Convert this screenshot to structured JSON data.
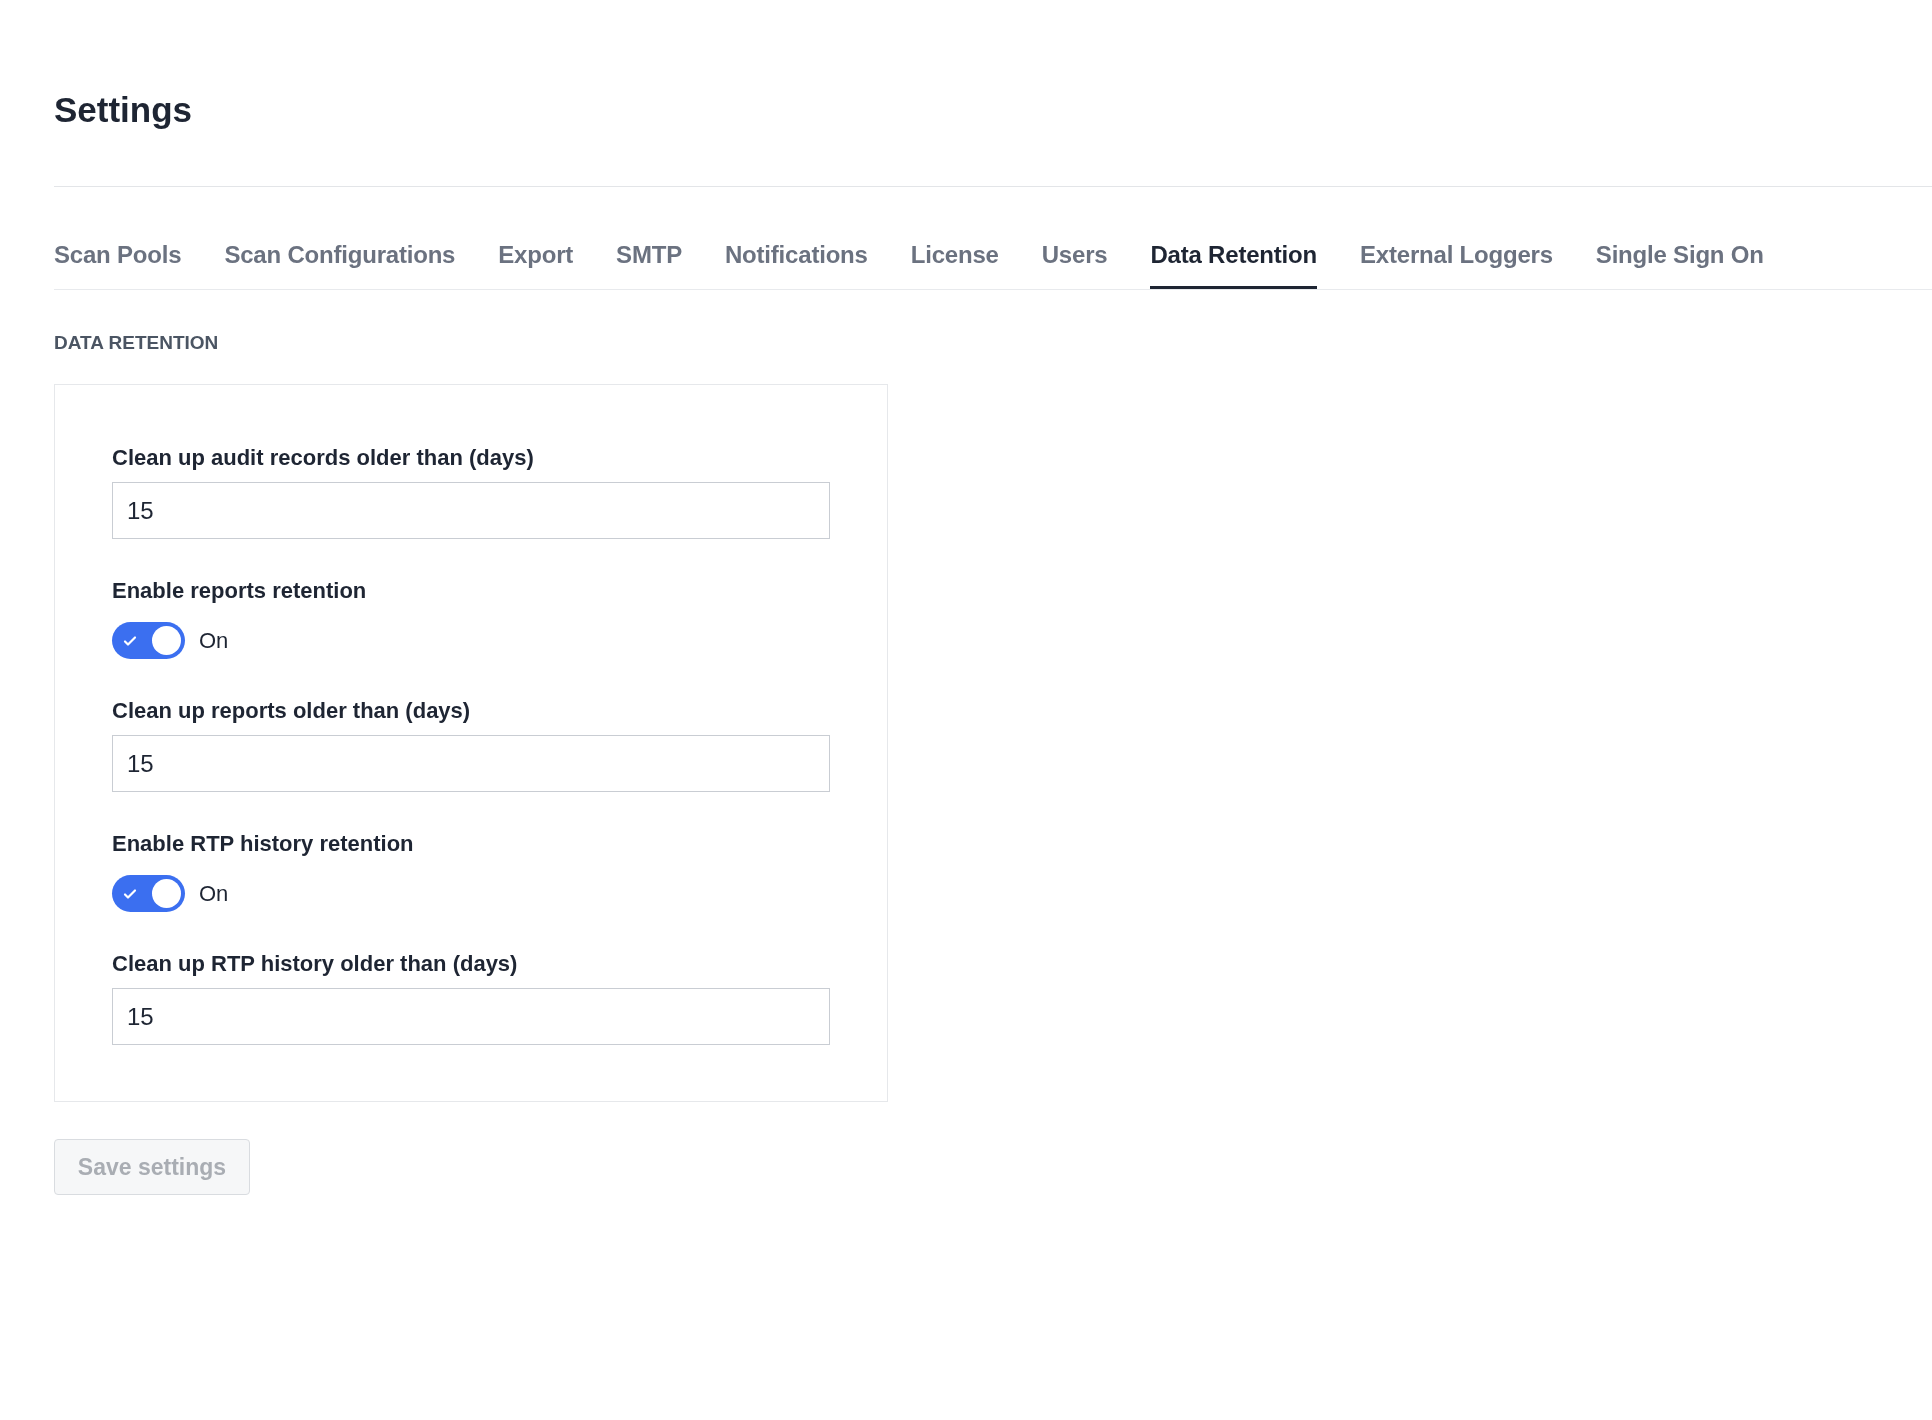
{
  "page": {
    "title": "Settings"
  },
  "tabs": [
    {
      "label": "Scan Pools",
      "selected": false
    },
    {
      "label": "Scan Configurations",
      "selected": false
    },
    {
      "label": "Export",
      "selected": false
    },
    {
      "label": "SMTP",
      "selected": false
    },
    {
      "label": "Notifications",
      "selected": false
    },
    {
      "label": "License",
      "selected": false
    },
    {
      "label": "Users",
      "selected": false
    },
    {
      "label": "Data Retention",
      "selected": true
    },
    {
      "label": "External Loggers",
      "selected": false
    },
    {
      "label": "Single Sign On",
      "selected": false
    }
  ],
  "section": {
    "heading": "DATA RETENTION",
    "fields": [
      {
        "kind": "number",
        "label": "Clean up audit records older than (days)",
        "value": "15"
      },
      {
        "kind": "toggle",
        "label": "Enable reports retention",
        "on": true,
        "state_label": "On"
      },
      {
        "kind": "number",
        "label": "Clean up reports older than (days)",
        "value": "15"
      },
      {
        "kind": "toggle",
        "label": "Enable RTP history retention",
        "on": true,
        "state_label": "On"
      },
      {
        "kind": "number",
        "label": "Clean up RTP history older than (days)",
        "value": "15"
      }
    ]
  },
  "save_button": {
    "label": "Save settings",
    "disabled": true
  }
}
